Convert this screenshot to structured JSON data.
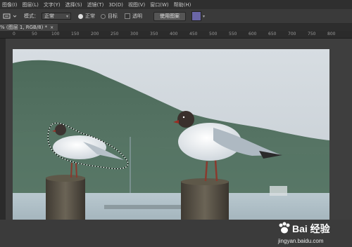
{
  "menu": [
    "图像(I)",
    "图层(L)",
    "文字(Y)",
    "选择(S)",
    "滤镜(T)",
    "3D(D)",
    "视图(V)",
    "窗口(W)",
    "帮助(H)"
  ],
  "options": {
    "feather_label": "模式：",
    "mode_value": "正常",
    "radio_normal": "正常",
    "radio_target": "目标",
    "check_transparent": "透明",
    "use_pattern_button": "使用图案"
  },
  "document_tab": "% (图层 1, RGB/8) *",
  "ruler_ticks": [
    "0",
    "50",
    "100",
    "150",
    "200",
    "250",
    "300",
    "350",
    "400",
    "450",
    "500",
    "550",
    "600",
    "650",
    "700",
    "750",
    "800"
  ],
  "watermark": {
    "brand": "Bai 经验",
    "url": "jingyan.baidu.com"
  },
  "colors": {
    "menubar": "#2f2f2f",
    "optionsbar": "#3a3a3a",
    "swatch": "#6a66a6"
  }
}
